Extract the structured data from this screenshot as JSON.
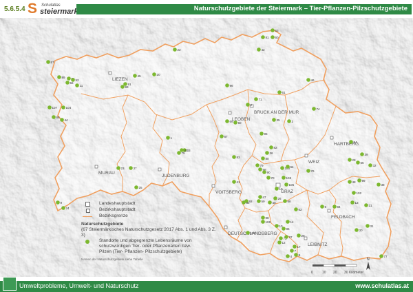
{
  "header": {
    "code": "5.6.5.4",
    "logo_top": "Schulatlas",
    "logo_main": "steiermark",
    "title": "Naturschutzgebiete der Steiermark – Tier-Pflanzen-Pilzschutzgebiete"
  },
  "footer": {
    "left": "Umweltprobleme, Umwelt- und Naturschutz",
    "right": "www.schulatlas.at"
  },
  "colors": {
    "accent": "#2f8a46",
    "border": "#f0a060",
    "dot": "#7cb82f"
  },
  "cities": [
    {
      "name": "LIEZEN"
    },
    {
      "name": "LEOBEN"
    },
    {
      "name": "BRUCK AN DER MUR"
    },
    {
      "name": "HARTBERG"
    },
    {
      "name": "WEIZ"
    },
    {
      "name": "MURAU"
    },
    {
      "name": "JUDENBURG"
    },
    {
      "name": "VOITSBERG"
    },
    {
      "name": "GRAZ"
    },
    {
      "name": "FELDBACH"
    },
    {
      "name": "DEUTSCHLANDSBERG"
    },
    {
      "name": "LEIBNITZ"
    }
  ],
  "points": [
    "63",
    "81",
    "60",
    "42",
    "22",
    "57",
    "89",
    "54",
    "56",
    "52",
    "11",
    "45",
    "20",
    "91",
    "93",
    "96",
    "71",
    "61",
    "46",
    "107",
    "104",
    "44",
    "88",
    "2",
    "35",
    "95",
    "94",
    "74",
    "69",
    "50",
    "3",
    "67",
    "28",
    "1",
    "83",
    "82",
    "39",
    "36",
    "80",
    "33",
    "79",
    "58",
    "90",
    "100",
    "64",
    "65",
    "76",
    "48",
    "32",
    "99",
    "75",
    "41",
    "43",
    "37",
    "23",
    "25",
    "24",
    "9",
    "10",
    "103",
    "105",
    "102",
    "38",
    "101",
    "19",
    "47",
    "70",
    "92",
    "68",
    "62",
    "73",
    "86",
    "12",
    "27",
    "17",
    "29",
    "7",
    "8",
    "4",
    "5",
    "84",
    "13",
    "14",
    "106",
    "21",
    "30",
    "31",
    "98",
    "34",
    "59",
    "40",
    "26",
    "77"
  ],
  "legend": {
    "state_capital": "Landeshauptstadt",
    "district_capital": "Bezirkshauptstadt",
    "district_border": "Bezirksgrenze",
    "heading": "Naturschutzgebiete",
    "subheading": "(67 Steiermärkisches Naturschutzgesetz 2017 Abs. 1 und Abs. 3 Z. 3)",
    "dot_text_1": "Standorte und abgegrenzte Lebensräume von",
    "dot_text_2": "schutzwürdigen Tier- oder Pflanzenarten bzw.",
    "dot_text_3": "Pilzen (Tier- Pflanzen- Pilzschutzgebiete)",
    "footnote": "Namen der Naturschutzgebiete siehe Tabelle"
  },
  "scale": {
    "labels": [
      "0",
      "10",
      "20",
      "30 Kilometer"
    ]
  },
  "north": "N"
}
